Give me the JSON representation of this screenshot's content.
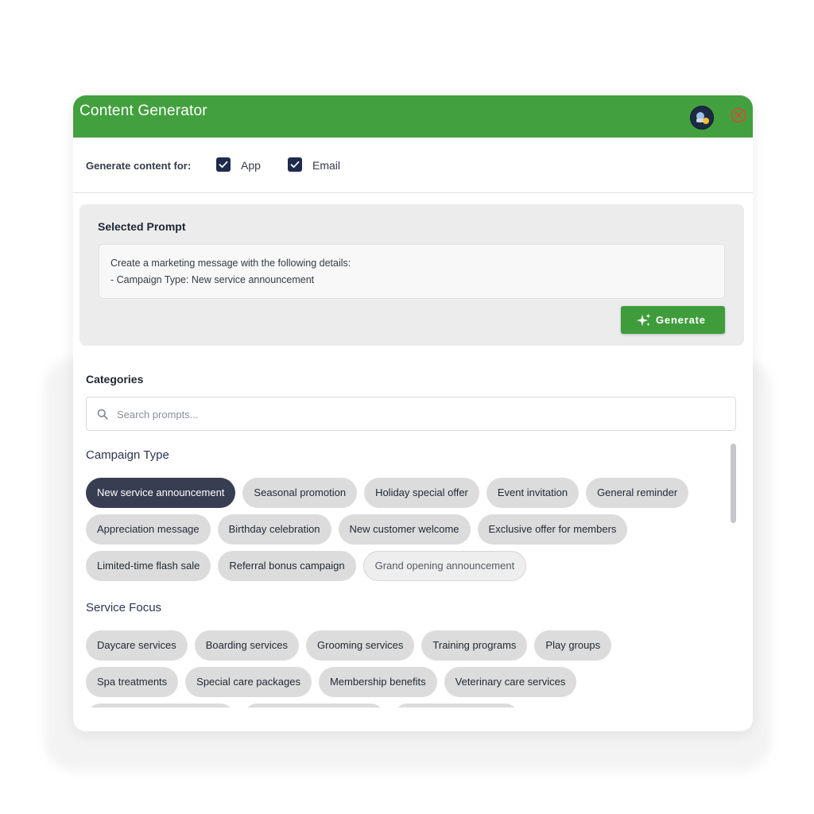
{
  "window": {
    "title": "Content Generator"
  },
  "options": {
    "label": "Generate content for:",
    "targets": [
      {
        "label": "App",
        "checked": true
      },
      {
        "label": "Email",
        "checked": true
      }
    ]
  },
  "selected_prompt": {
    "heading": "Selected Prompt",
    "lines": [
      "Create a marketing message with the following details:",
      "- Campaign Type: New service announcement"
    ],
    "generate_label": "Generate"
  },
  "categories": {
    "heading": "Categories",
    "search_placeholder": "Search prompts...",
    "sections": [
      {
        "title": "Campaign Type",
        "rows": [
          [
            "New service announcement",
            "Seasonal promotion",
            "Holiday special offer",
            "Event invitation",
            "General reminder"
          ],
          [
            "Appreciation message",
            "Birthday celebration",
            "New customer welcome",
            "Exclusive offer for members"
          ],
          [
            "Limited-time flash sale",
            "Referral bonus campaign",
            "Grand opening announcement"
          ]
        ],
        "selected": "New service announcement",
        "hovered": "Grand opening announcement"
      },
      {
        "title": "Service Focus",
        "rows": [
          [
            "Daycare services",
            "Boarding services",
            "Grooming services",
            "Training programs",
            "Play groups"
          ],
          [
            "Spa treatments",
            "Special care packages",
            "Membership benefits",
            "Veterinary care services"
          ]
        ]
      }
    ]
  },
  "colors": {
    "header_green": "#43a03e",
    "button_green": "#3f9c3b",
    "chip_active": "#373e52",
    "checkbox": "#1f2b4d",
    "close_red": "#e0453a"
  },
  "icons": {
    "close": "close-circle-icon",
    "generate": "sparkle-icon",
    "search": "search-icon",
    "check": "checkmark-icon"
  }
}
